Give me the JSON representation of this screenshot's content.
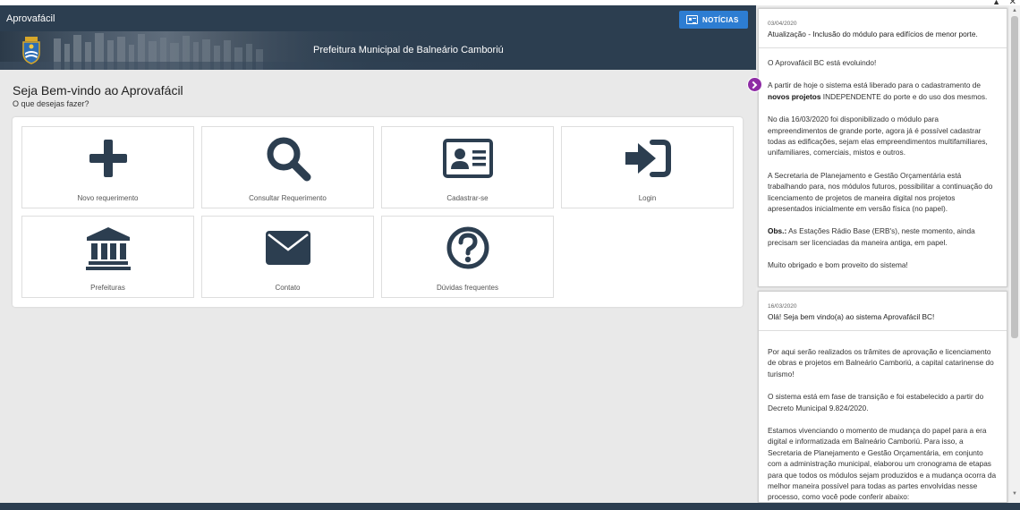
{
  "header": {
    "app_title": "Aprovafácil",
    "news_button": "NOTÍCIAS"
  },
  "banner": {
    "title": "Prefeitura Municipal de Balneário Camboriú"
  },
  "welcome": {
    "title": "Seja Bem-vindo ao Aprovafácil",
    "subtitle": "O que desejas fazer?"
  },
  "tiles": [
    {
      "label": "Novo requerimento",
      "icon": "plus-icon"
    },
    {
      "label": "Consultar Requerimento",
      "icon": "search-icon"
    },
    {
      "label": "Cadastrar-se",
      "icon": "id-card-icon"
    },
    {
      "label": "Login",
      "icon": "sign-in-icon"
    },
    {
      "label": "Prefeituras",
      "icon": "bank-icon"
    },
    {
      "label": "Contato",
      "icon": "envelope-icon"
    },
    {
      "label": "Dúvidas frequentes",
      "icon": "question-icon"
    }
  ],
  "news": [
    {
      "date": "03/04/2020",
      "headline": "Atualização - Inclusão do módulo para edifícios de menor porte.",
      "paragraphs": {
        "p1": "O Aprovafácil BC está evoluindo!",
        "p2_a": "A partir de hoje o sistema está liberado para o cadastramento de",
        "p2_bold": "novos projetos",
        "p2_b": "INDEPENDENTE do porte e do uso dos mesmos.",
        "p3": "No dia 16/03/2020 foi disponibilizado o módulo para empreendimentos de grande porte, agora já é possível cadastrar todas as edificações, sejam elas empreendimentos multifamiliares, unifamiliares, comerciais, mistos e outros.",
        "p4": "A Secretaria de Planejamento e Gestão Orçamentária está trabalhando para, nos módulos futuros, possibilitar a continuação do licenciamento de projetos de maneira digital nos projetos apresentados inicialmente em versão física (no papel).",
        "p5_bold": "Obs.:",
        "p5": "As Estações Rádio Base (ERB's), neste momento, ainda precisam ser licenciadas da maneira antiga, em papel.",
        "p6": "Muito obrigado e bom proveito do sistema!"
      }
    },
    {
      "date": "16/03/2020",
      "headline": "Olá! Seja bem vindo(a) ao sistema Aprovafácil BC!",
      "paragraphs": {
        "p1": "Por aqui serão realizados os trâmites de aprovação e licenciamento de obras e projetos em Balneário Camboriú, a capital catarinense do turismo!",
        "p2": "O sistema está em fase de transição e foi estabelecido a partir do Decreto Municipal 9.824/2020.",
        "p3": "Estamos vivenciando o momento de mudança do papel para a era digital e informatizada em Balneário Camboriú. Para isso, a Secretaria de Planejamento e Gestão Orçamentária, em conjunto com a administração municipal, elaborou um cronograma de etapas para que todos os módulos sejam produzidos e a mudança ocorra da melhor maneira possível para todas as partes envolvidas nesse processo, como você pode conferir abaixo:"
      }
    }
  ],
  "colors": {
    "header": "#2c3e50",
    "accent": "#2d7dd2",
    "icon": "#2c3e50",
    "expand": "#8e2ba5"
  }
}
